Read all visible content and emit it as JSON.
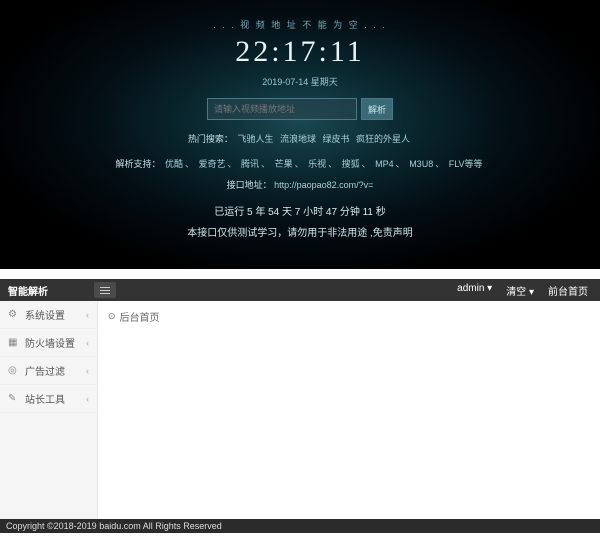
{
  "top": {
    "notice": ". . . 视 频 地 址 不 能 为 空 . . .",
    "clock": "22:17:11",
    "date": "2019-07-14 星期天",
    "search_placeholder": "请输入视频播放地址",
    "search_btn": "解析",
    "hot_label": "热门搜索：",
    "hot_links": [
      "飞驰人生",
      "流浪地球",
      "绿皮书",
      "疯狂的外星人"
    ],
    "support_label": "解析支持：",
    "support_links": [
      "优酷",
      "爱奇艺",
      "腾讯",
      "芒果",
      "乐视",
      "搜狐",
      "MP4",
      "M3U8",
      "FLV等等"
    ],
    "interface_label": "接口地址：",
    "interface_url": "http://paopao82.com/?v=",
    "runtime": "已运行 5 年 54 天 7 小时 47 分钟 11 秒",
    "disclaimer": "本接口仅供测试学习，请勿用于非法用途 ,免责声明"
  },
  "admin": {
    "brand": "智能解析",
    "topbar": {
      "user": "admin ▾",
      "clear": "清空 ▾",
      "home": "前台首页"
    },
    "sidebar": [
      {
        "icon": "⚙",
        "label": "系统设置"
      },
      {
        "icon": "▦",
        "label": "防火墙设置"
      },
      {
        "icon": "◎",
        "label": "广告过滤"
      },
      {
        "icon": "✎",
        "label": "站长工具"
      }
    ],
    "crumb_icon": "⊙",
    "crumb": "后台首页"
  },
  "footer": "Copyright ©2018-2019 baidu.com All Rights Reserved"
}
